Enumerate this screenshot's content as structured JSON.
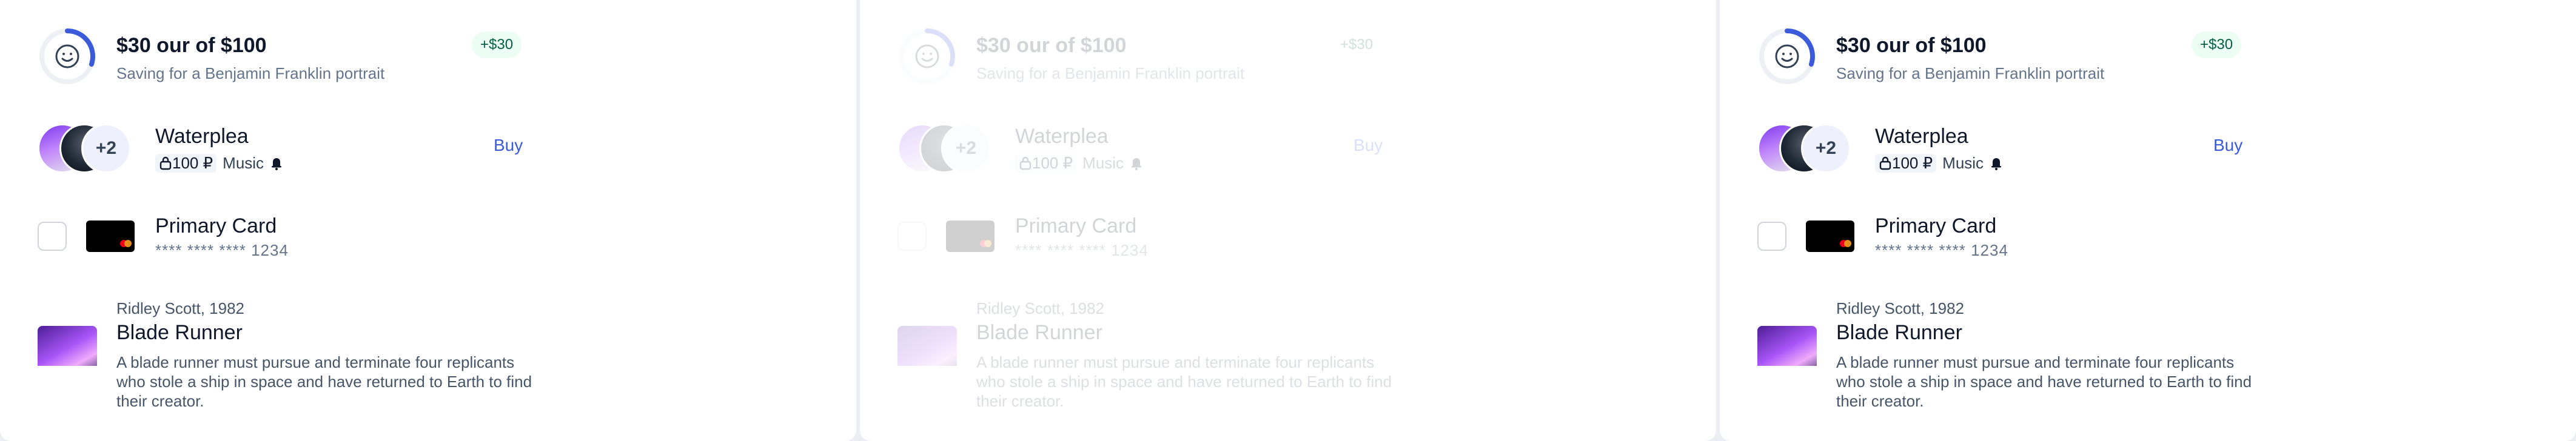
{
  "savings": {
    "title": "$30 our of $100",
    "subtitle": "Saving for a Benjamin Franklin portrait",
    "badge": "+$30",
    "progress": 0.3,
    "accent_color": "#3b5bdb"
  },
  "music": {
    "title": "Waterplea",
    "price": "100 ₽",
    "genre": "Music",
    "extra_avatars": "+2",
    "buy_label": "Buy"
  },
  "card": {
    "title": "Primary Card",
    "number": "**** **** **** 1234"
  },
  "movie": {
    "meta": "Ridley Scott, 1982",
    "title": "Blade Runner",
    "description": "A blade runner must pursue and terminate four replicants who stole a ship in space and have returned to Earth to find their creator."
  },
  "icons": {
    "ring": "smile-progress-icon",
    "lock": "lock-icon",
    "bell": "bell-icon",
    "card_brand": "mastercard-icon"
  }
}
